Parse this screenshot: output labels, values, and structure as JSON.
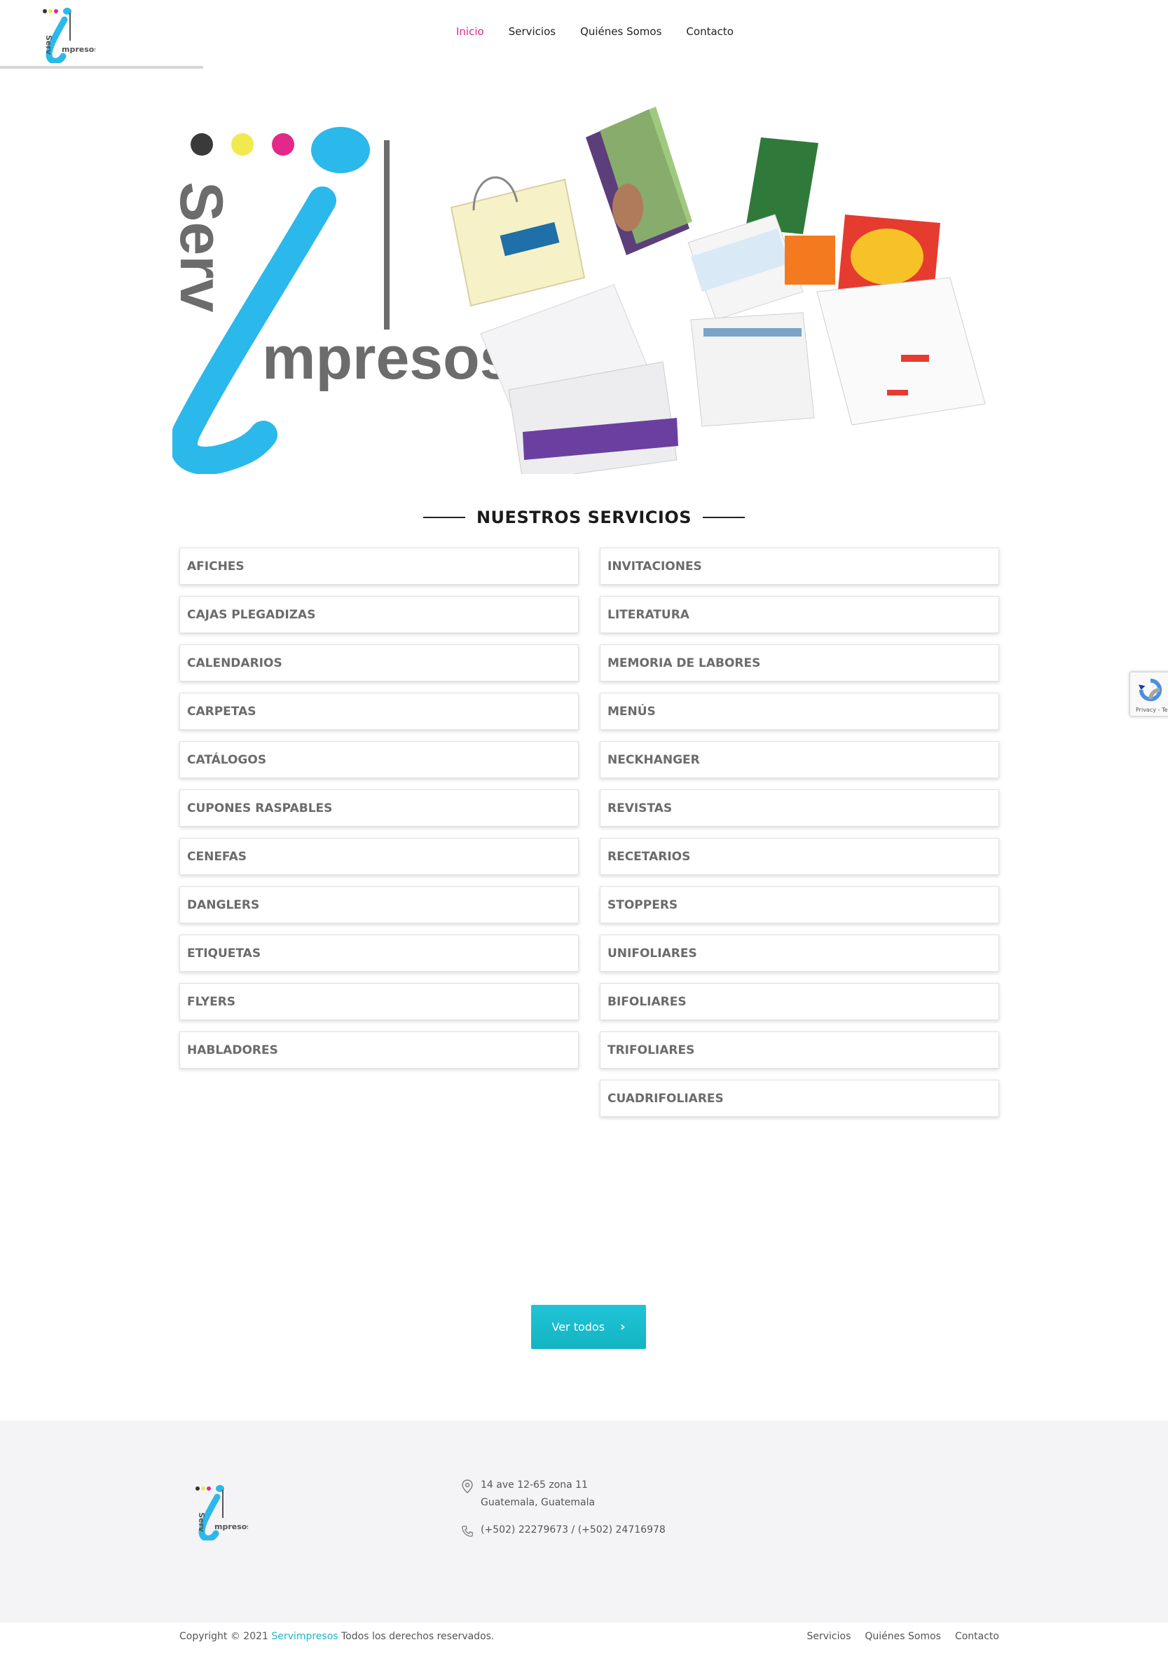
{
  "header": {
    "nav": [
      "Inicio",
      "Servicios",
      "Quiénes Somos",
      "Contacto"
    ],
    "active": "Inicio"
  },
  "logo": {
    "text_top": "Serv",
    "text_bottom": "mpresos"
  },
  "services": {
    "title": "NUESTROS SERVICIOS",
    "left": [
      "AFICHES",
      "CAJAS PLEGADIZAS",
      "CALENDARIOS",
      "CARPETAS",
      "CATÁLOGOS",
      "CUPONES RASPABLES",
      "CENEFAS",
      "DANGLERS",
      "ETIQUETAS",
      "FLYERS",
      "HABLADORES"
    ],
    "right": [
      "INVITACIONES",
      "LITERATURA",
      "MEMORIA DE LABORES",
      "MENÚS",
      "NECKHANGER",
      "REVISTAS",
      "RECETARIOS",
      "STOPPERS",
      "UNIFOLIARES",
      "BIFOLIARES",
      "TRIFOLIARES",
      "CUADRIFOLIARES"
    ]
  },
  "cta": {
    "label": "Ver todos",
    "icon": "chevron-right-icon"
  },
  "recaptcha": {
    "text": "Privacy - Terms"
  },
  "footer": {
    "address_line1": "14 ave 12-65 zona 11",
    "address_line2": "Guatemala, Guatemala",
    "phone": "(+502) 22279673 / (+502) 24716978"
  },
  "bottom": {
    "copy_prefix": "Copyright © 2021 ",
    "brand": "Servimpresos",
    "copy_suffix": " Todos los derechos reservados.",
    "links": [
      "Servicios",
      "Quiénes Somos",
      "Contacto"
    ]
  },
  "colors": {
    "cyan": "#1eb6c7",
    "magenta": "#e2288a",
    "yellow": "#f2e94e",
    "black": "#333333",
    "logo_blue": "#2bb8ea"
  }
}
